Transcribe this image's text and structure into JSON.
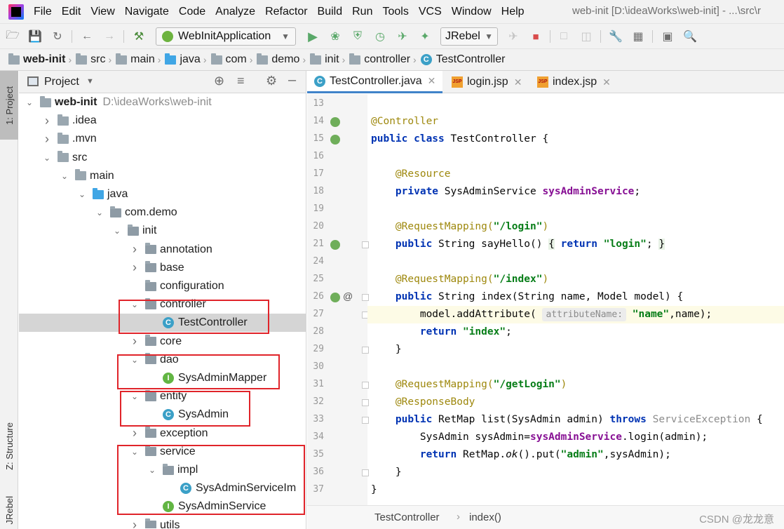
{
  "menubar": {
    "items": [
      "File",
      "Edit",
      "View",
      "Navigate",
      "Code",
      "Analyze",
      "Refactor",
      "Build",
      "Run",
      "Tools",
      "VCS",
      "Window",
      "Help"
    ],
    "title": "web-init [D:\\ideaWorks\\web-init] - ...\\src\\r"
  },
  "toolbar": {
    "run_config": "WebInitApplication",
    "jrebel": "JRebel"
  },
  "breadcrumb": [
    "web-init",
    "src",
    "main",
    "java",
    "com",
    "demo",
    "init",
    "controller",
    "TestController"
  ],
  "sidebar": {
    "project_tab": "1: Project",
    "structure_tab": "Z: Structure",
    "jrebel_tab": "JRebel"
  },
  "project": {
    "title": "Project",
    "root_name": "web-init",
    "root_path": "D:\\ideaWorks\\web-init",
    "tree": [
      {
        "label": "web-init",
        "depth": 0,
        "kind": "module",
        "expanded": true
      },
      {
        "label": ".idea",
        "depth": 1,
        "kind": "folder",
        "expanded": false
      },
      {
        "label": ".mvn",
        "depth": 1,
        "kind": "folder",
        "expanded": false
      },
      {
        "label": "src",
        "depth": 1,
        "kind": "folder",
        "expanded": true
      },
      {
        "label": "main",
        "depth": 2,
        "kind": "folder",
        "expanded": true
      },
      {
        "label": "java",
        "depth": 3,
        "kind": "source",
        "expanded": true
      },
      {
        "label": "com.demo",
        "depth": 4,
        "kind": "package",
        "expanded": true
      },
      {
        "label": "init",
        "depth": 5,
        "kind": "package",
        "expanded": true
      },
      {
        "label": "annotation",
        "depth": 6,
        "kind": "package",
        "expanded": false
      },
      {
        "label": "base",
        "depth": 6,
        "kind": "package",
        "expanded": false
      },
      {
        "label": "configuration",
        "depth": 6,
        "kind": "package",
        "expanded": null
      },
      {
        "label": "controller",
        "depth": 6,
        "kind": "package",
        "expanded": true
      },
      {
        "label": "TestController",
        "depth": 7,
        "kind": "class",
        "selected": true
      },
      {
        "label": "core",
        "depth": 6,
        "kind": "package",
        "expanded": false
      },
      {
        "label": "dao",
        "depth": 6,
        "kind": "package",
        "expanded": true
      },
      {
        "label": "SysAdminMapper",
        "depth": 7,
        "kind": "interface"
      },
      {
        "label": "entity",
        "depth": 6,
        "kind": "package",
        "expanded": true
      },
      {
        "label": "SysAdmin",
        "depth": 7,
        "kind": "class"
      },
      {
        "label": "exception",
        "depth": 6,
        "kind": "package",
        "expanded": false
      },
      {
        "label": "service",
        "depth": 6,
        "kind": "package",
        "expanded": true
      },
      {
        "label": "impl",
        "depth": 7,
        "kind": "package",
        "expanded": true
      },
      {
        "label": "SysAdminServiceIm",
        "depth": 8,
        "kind": "class"
      },
      {
        "label": "SysAdminService",
        "depth": 7,
        "kind": "interface"
      },
      {
        "label": "utils",
        "depth": 6,
        "kind": "package",
        "expanded": false
      }
    ]
  },
  "editor": {
    "tabs": [
      {
        "label": "TestController.java",
        "kind": "class",
        "active": true
      },
      {
        "label": "login.jsp",
        "kind": "jsp",
        "active": false
      },
      {
        "label": "index.jsp",
        "kind": "jsp",
        "active": false
      }
    ],
    "lines": [
      {
        "num": "13"
      },
      {
        "num": "14"
      },
      {
        "num": "15"
      },
      {
        "num": "16"
      },
      {
        "num": "17"
      },
      {
        "num": "18"
      },
      {
        "num": "19"
      },
      {
        "num": "20"
      },
      {
        "num": "21"
      },
      {
        "num": "24"
      },
      {
        "num": "25"
      },
      {
        "num": "26"
      },
      {
        "num": "27"
      },
      {
        "num": "28"
      },
      {
        "num": "29"
      },
      {
        "num": "30"
      },
      {
        "num": "31"
      },
      {
        "num": "32"
      },
      {
        "num": "33"
      },
      {
        "num": "34"
      },
      {
        "num": "35"
      },
      {
        "num": "36"
      },
      {
        "num": "37"
      }
    ],
    "code": {
      "l14": "@Controller",
      "l15": "public class TestController {",
      "l17": "@Resource",
      "l18_kw": "private",
      "l18_type": "SysAdminService",
      "l18_field": "sysAdminService",
      "l20_ann": "@RequestMapping(",
      "l20_str": "\"/login\"",
      "l21_a": "public String sayHello()",
      "l21_b": "{",
      "l21_ret": "return",
      "l21_str": "\"login\"",
      "l21_c": "; }",
      "l25_str": "\"/index\"",
      "l26": "public String index(String name, Model model) {",
      "l27_a": "model.addAttribute(",
      "l27_hint": "attributeName:",
      "l27_str": "\"name\"",
      "l27_b": ",name);",
      "l28_ret": "return",
      "l28_str": "\"index\"",
      "l29": "}",
      "l31_str": "\"/getLogin\"",
      "l32": "@ResponseBody",
      "l33_a": "public RetMap list(SysAdmin admin)",
      "l33_throws": "throws",
      "l33_ex": "ServiceException",
      "l33_b": "{",
      "l34_a": "SysAdmin sysAdmin=",
      "l34_field": "sysAdminService",
      "l34_b": ".login(admin);",
      "l35_ret": "return",
      "l35_a": "RetMap.",
      "l35_ok": "ok",
      "l35_b": "().put(",
      "l35_str": "\"admin\"",
      "l35_c": ",sysAdmin);",
      "l36": "}",
      "l37": "}"
    },
    "status": {
      "class": "TestController",
      "method": "index()"
    }
  },
  "watermark": "CSDN @龙龙意",
  "colors": {
    "highlight_box": "#e0242a",
    "accent_tab": "#4083c9",
    "keyword": "#0033b3",
    "annotation": "#9e880d",
    "string": "#067d17"
  }
}
